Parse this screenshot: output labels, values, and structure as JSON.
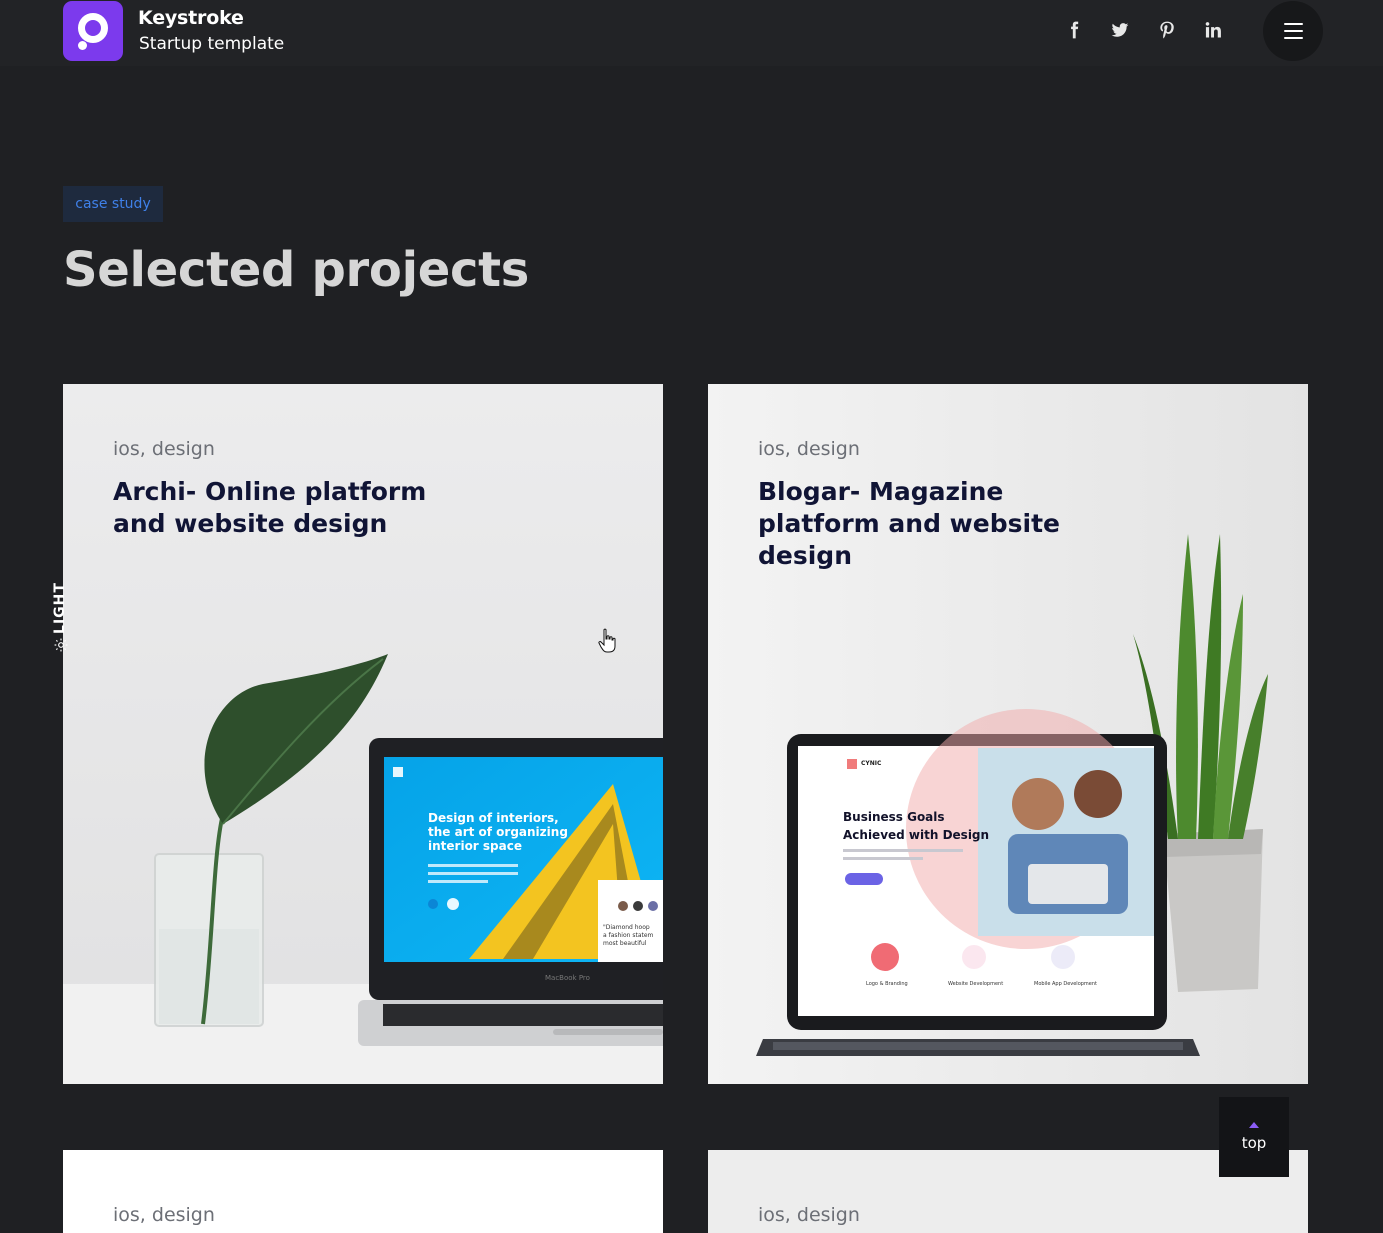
{
  "brand": {
    "name": "Keystroke",
    "tagline": "Startup template",
    "accent": "#7c3aed"
  },
  "social": [
    {
      "name": "facebook",
      "icon": "facebook-icon"
    },
    {
      "name": "twitter",
      "icon": "twitter-icon"
    },
    {
      "name": "pinterest",
      "icon": "pinterest-icon"
    },
    {
      "name": "linkedin",
      "icon": "linkedin-icon"
    }
  ],
  "menu": {
    "icon": "hamburger-icon"
  },
  "section": {
    "badge": "case study",
    "title": "Selected projects"
  },
  "projects": [
    {
      "tags": "ios, design",
      "title": "Archi- Online platform and website design",
      "mockup": {
        "headline": "Design of interiors, the art of organizing interior space",
        "device": "MacBook Pro",
        "quote": "\"Diamond hoop a fashion statem most beautiful"
      }
    },
    {
      "tags": "ios, design",
      "title": "Blogar- Magazine platform and website design",
      "mockup": {
        "brand": "CYNIC",
        "headline_line1": "Business Goals",
        "headline_line2": "Achieved with Design",
        "services": [
          "Logo & Branding",
          "Website Development",
          "Mobile App Development"
        ]
      }
    },
    {
      "tags": "ios, design"
    },
    {
      "tags": "ios, design"
    }
  ],
  "theme_toggle": {
    "label": "LIGHT",
    "icon": "sun-icon"
  },
  "scroll_top": {
    "label": "top",
    "icon": "arrow-up-icon"
  }
}
